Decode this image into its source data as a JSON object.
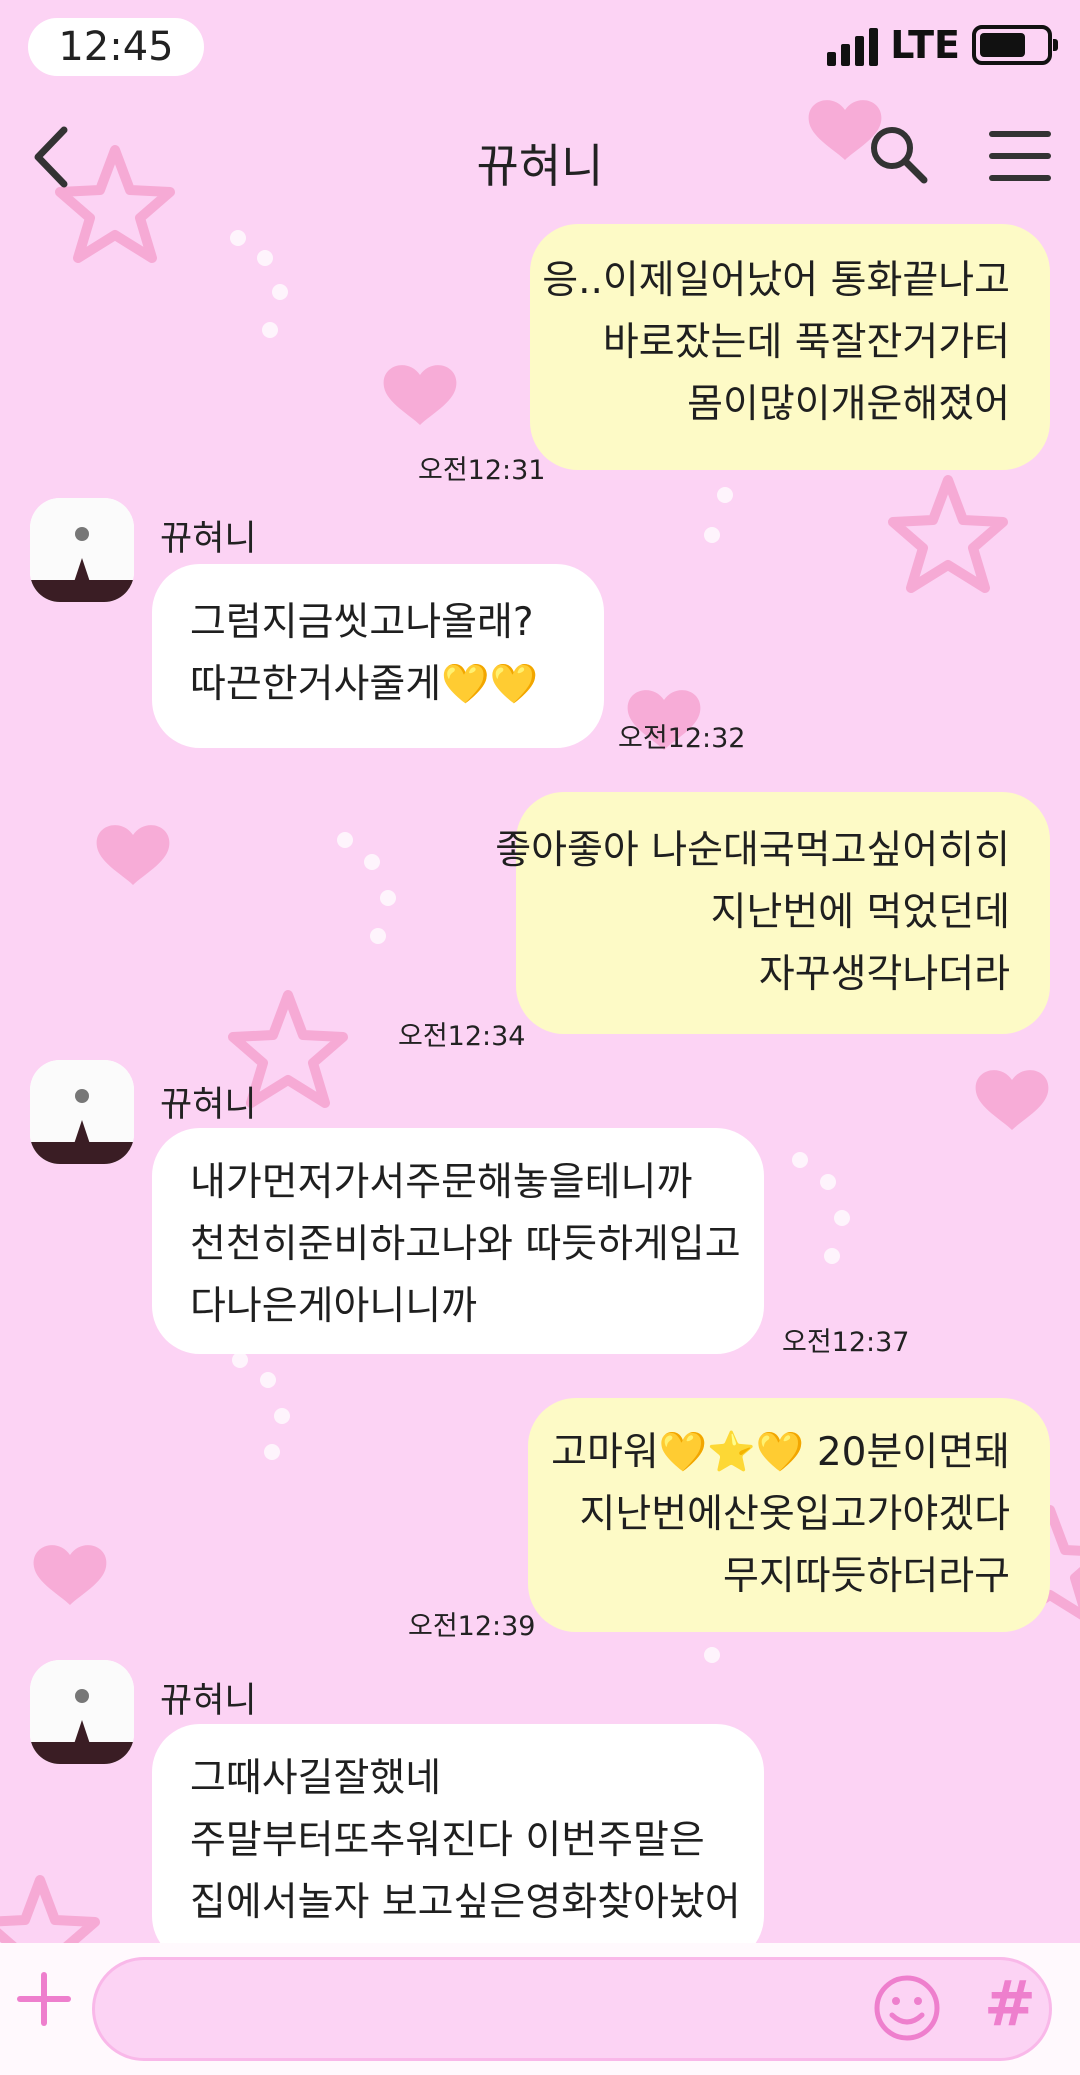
{
  "status_bar": {
    "time": "12:45",
    "network": "LTE"
  },
  "header": {
    "title": "뀨혀니"
  },
  "colors": {
    "background": "#fcd3f4",
    "outgoing_bubble": "#fdfac6",
    "incoming_bubble": "#ffffff",
    "accent": "#ee7fcd"
  },
  "messages": [
    {
      "direction": "out",
      "lines": [
        "응..이제일어났어 통화끝나고",
        "바로잤는데 푹잘잔거가터",
        "몸이많이개운해졌어"
      ],
      "time": "오전12:31"
    },
    {
      "direction": "in",
      "sender": "뀨혀니",
      "lines": [
        "그럼지금씻고나올래?",
        "따끈한거사줄게💛💛"
      ],
      "time": "오전12:32"
    },
    {
      "direction": "out",
      "lines": [
        "좋아좋아 나순대국먹고싶어히히",
        "지난번에 먹었던데",
        "자꾸생각나더라"
      ],
      "time": "오전12:34"
    },
    {
      "direction": "in",
      "sender": "뀨혀니",
      "lines": [
        "내가먼저가서주문해놓을테니까",
        "천천히준비하고나와 따듯하게입고",
        "다나은게아니니까"
      ],
      "time": "오전12:37"
    },
    {
      "direction": "out",
      "lines": [
        "고마워💛⭐💛 20분이면돼",
        "지난번에산옷입고가야겠다",
        "무지따듯하더라구"
      ],
      "time": "오전12:39"
    },
    {
      "direction": "in",
      "sender": "뀨혀니",
      "lines": [
        "그때사길잘했네",
        "주말부터또추워진다 이번주말은",
        "집에서놀자 보고싶은영화찾아놨어"
      ]
    }
  ],
  "icons": [
    "back-arrow-icon",
    "search-icon",
    "menu-icon",
    "plus-icon",
    "emoji-icon",
    "hashtag-icon"
  ],
  "input": {
    "hashtag": "#"
  }
}
